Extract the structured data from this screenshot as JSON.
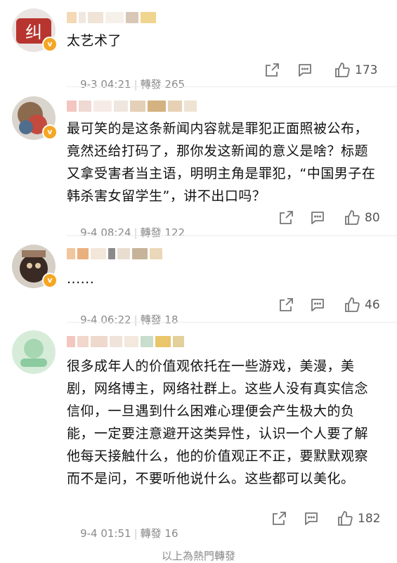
{
  "comments": [
    {
      "text": "太艺术了",
      "date": "9-3 04:21",
      "repost": "轉發 265",
      "likes": "173"
    },
    {
      "text": "最可笑的是这条新闻内容就是罪犯正面照被公布，竟然还给打码了，那你发这新闻的意义是啥？标题又拿受害者当主语，明明主角是罪犯，“中国男子在韩杀害女留学生”，讲不出口吗？",
      "date": "9-4 08:24",
      "repost": "轉發 122",
      "likes": "80"
    },
    {
      "text": "......",
      "date": "9-4 06:22",
      "repost": "轉發 18",
      "likes": "46"
    },
    {
      "text": "很多成年人的价值观依托在一些游戏，美漫，美剧，网络博主，网络社群上。这些人没有真实信念信仰，一旦遇到什么困难心理便会产生极大的负能，一定要注意避开这类异性，认识一个人要了解他每天接触什么，他的价值观正不正，要默默观察而不是问，不要听他说什么。这些都可以美化。",
      "date": "9-4 01:51",
      "repost": "轉發 16",
      "likes": "182"
    }
  ],
  "footer": "以上為熱門轉發",
  "colors": {
    "badge": "#f5a623",
    "meta": "#8a8a8a"
  }
}
